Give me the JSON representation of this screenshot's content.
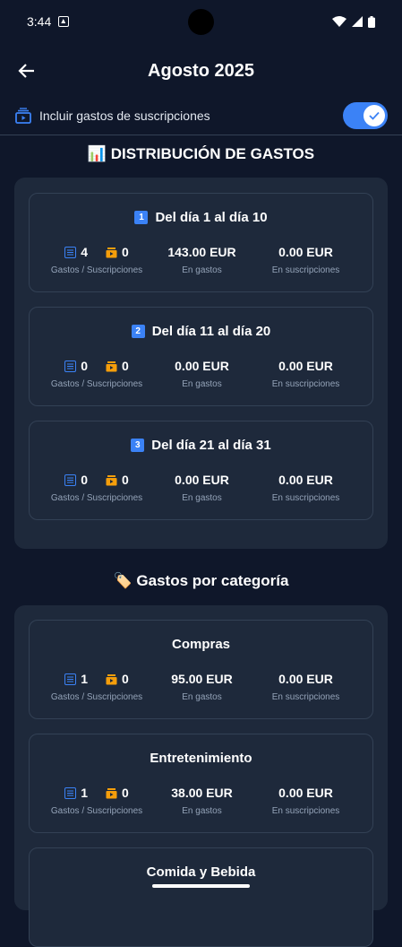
{
  "status": {
    "time": "3:44"
  },
  "header": {
    "title": "Agosto 2025"
  },
  "toggle": {
    "label": "Incluir gastos de suscripciones",
    "on": true
  },
  "distribution": {
    "heading_emoji": "📊",
    "heading": "DISTRIBUCIÓN DE GASTOS",
    "cards": [
      {
        "num": "1",
        "title": "Del día 1 al día 10",
        "gastos": "4",
        "suscripciones": "0",
        "en_gastos": "143.00 EUR",
        "en_suscripciones": "0.00 EUR"
      },
      {
        "num": "2",
        "title": "Del día 11 al día 20",
        "gastos": "0",
        "suscripciones": "0",
        "en_gastos": "0.00 EUR",
        "en_suscripciones": "0.00 EUR"
      },
      {
        "num": "3",
        "title": "Del día 21 al día 31",
        "gastos": "0",
        "suscripciones": "0",
        "en_gastos": "0.00 EUR",
        "en_suscripciones": "0.00 EUR"
      }
    ]
  },
  "labels": {
    "gastos_suscripciones": "Gastos / Suscripciones",
    "en_gastos": "En gastos",
    "en_suscripciones": "En suscripciones"
  },
  "categories": {
    "heading_emoji": "🏷️",
    "heading": "Gastos por categoría",
    "cards": [
      {
        "title": "Compras",
        "gastos": "1",
        "suscripciones": "0",
        "en_gastos": "95.00 EUR",
        "en_suscripciones": "0.00 EUR"
      },
      {
        "title": "Entretenimiento",
        "gastos": "1",
        "suscripciones": "0",
        "en_gastos": "38.00 EUR",
        "en_suscripciones": "0.00 EUR"
      },
      {
        "title": "Comida y Bebida"
      }
    ]
  },
  "colors": {
    "accent": "#3b82f6",
    "background": "#0f172a",
    "panel": "#1e293b",
    "subscription_icon": "#f59e0b"
  }
}
